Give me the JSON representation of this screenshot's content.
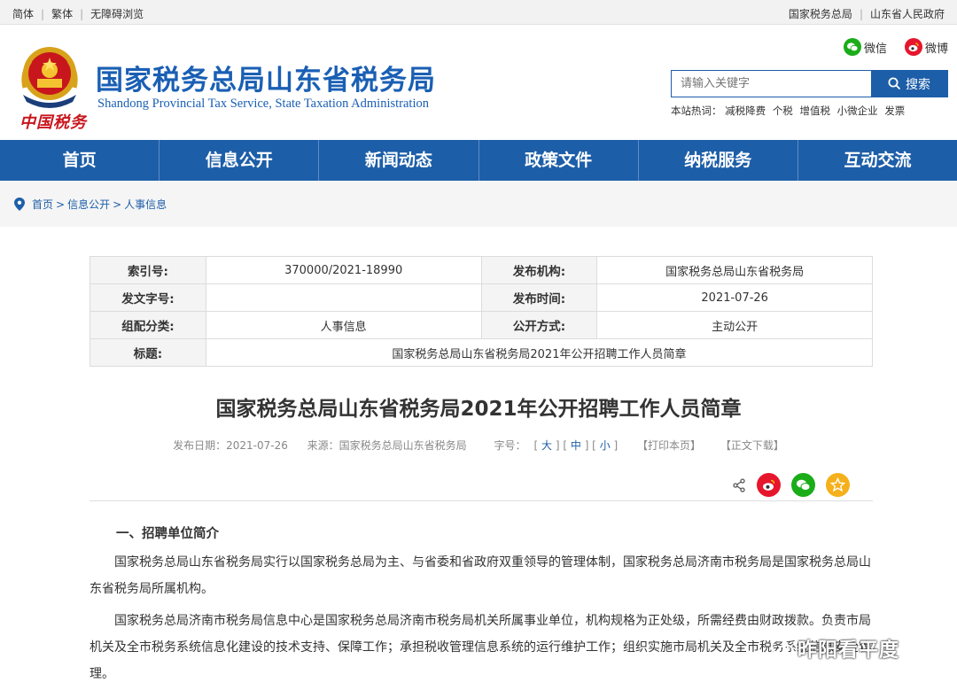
{
  "topbar": {
    "left": [
      "简体",
      "繁体",
      "无障碍浏览"
    ],
    "right": [
      "国家税务总局",
      "山东省人民政府"
    ]
  },
  "header": {
    "emblem_text": "中国税务",
    "title": "国家税务总局山东省税务局",
    "subtitle": "Shandong Provincial Tax Service, State Taxation Administration",
    "social": {
      "wechat": "微信",
      "weibo": "微博"
    },
    "search": {
      "placeholder": "请输入关键字",
      "button": "搜索"
    },
    "hot": {
      "label": "本站热词：",
      "items": [
        "减税降费",
        "个税",
        "增值税",
        "小微企业",
        "发票"
      ]
    }
  },
  "nav": [
    "首页",
    "信息公开",
    "新闻动态",
    "政策文件",
    "纳税服务",
    "互动交流"
  ],
  "breadcrumb": [
    "首页",
    "信息公开",
    "人事信息"
  ],
  "info": {
    "index_label": "索引号:",
    "index_value": "370000/2021-18990",
    "org_label": "发布机构:",
    "org_value": "国家税务总局山东省税务局",
    "docno_label": "发文字号:",
    "docno_value": "",
    "date_label": "发布时间:",
    "date_value": "2021-07-26",
    "category_label": "组配分类:",
    "category_value": "人事信息",
    "mode_label": "公开方式:",
    "mode_value": "主动公开",
    "title_label": "标题:",
    "title_value": "国家税务总局山东省税务局2021年公开招聘工作人员简章"
  },
  "article": {
    "title": "国家税务总局山东省税务局2021年公开招聘工作人员简章",
    "meta": {
      "date": "发布日期：2021-07-26",
      "source": "来源：国家税务总局山东省税务局",
      "size_label": "字号：",
      "size_large": "大",
      "size_medium": "中",
      "size_small": "小",
      "print": "【打印本页】",
      "download": "【正文下载】"
    },
    "section1": "一、招聘单位简介",
    "para1": "国家税务总局山东省税务局实行以国家税务总局为主、与省委和省政府双重领导的管理体制，国家税务总局济南市税务局是国家税务总局山东省税务局所属机构。",
    "para2": "国家税务总局济南市税务局信息中心是国家税务总局济南市税务局机关所属事业单位，机构规格为正处级，所需经费由财政拨款。负责市局机关及全市税务系统信息化建设的技术支持、保障工作；承担税收管理信息系统的运行维护工作；组织实施市局机关及全市税务系统信息安全管理。"
  },
  "watermark": "昨阳看平度",
  "colors": {
    "brand_blue": "#1d5ea8",
    "red": "#c8161d",
    "wechat_green": "#1aad19",
    "weibo_red": "#e6162d",
    "fav_gold": "#f5b01b"
  }
}
